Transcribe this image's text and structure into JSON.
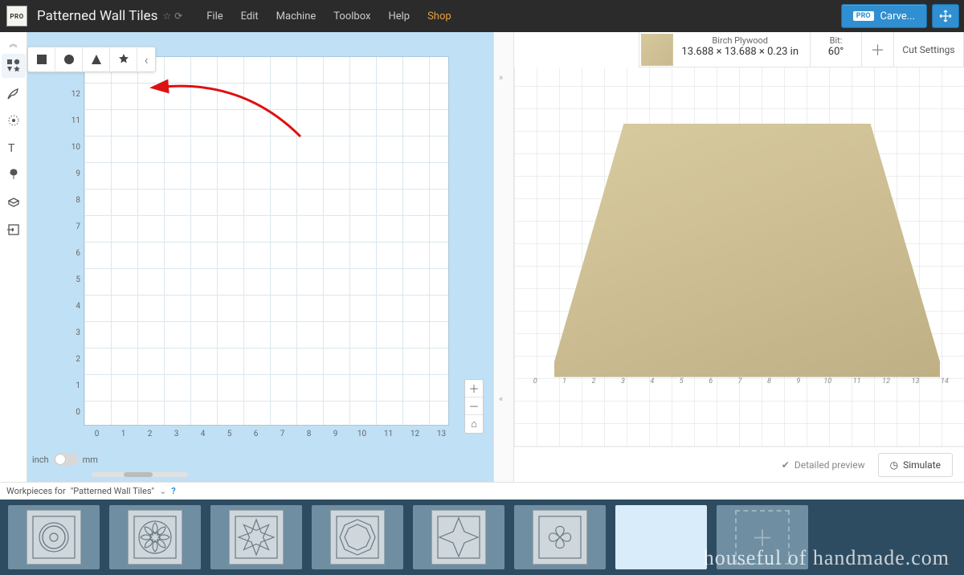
{
  "menubar": {
    "project_title": "Patterned Wall Tiles",
    "menus": [
      "File",
      "Edit",
      "Machine",
      "Toolbox",
      "Help",
      "Shop"
    ],
    "carve_label": "Carve...",
    "pro_badge": "PRO"
  },
  "left_tools": {
    "items": [
      "shapes-tool",
      "pen-tool",
      "drill-tool",
      "text-tool",
      "apps-tool",
      "blocks-tool",
      "import-tool"
    ]
  },
  "shape_flyout": {
    "shapes": [
      "square",
      "circle",
      "triangle",
      "star"
    ]
  },
  "canvas": {
    "ruler_ticks": [
      "0",
      "1",
      "2",
      "3",
      "4",
      "5",
      "6",
      "7",
      "8",
      "9",
      "10",
      "11",
      "12",
      "13"
    ],
    "unit_left": "inch",
    "unit_right": "mm"
  },
  "preview": {
    "material_name": "Birch Plywood",
    "material_dims": "13.688 × 13.688 × 0.23 in",
    "bit_label": "Bit:",
    "bit_value": "60°",
    "cut_settings": "Cut Settings",
    "axis_ticks": [
      "0",
      "1",
      "2",
      "3",
      "4",
      "5",
      "6",
      "7",
      "8",
      "9",
      "10",
      "11",
      "12",
      "13",
      "14"
    ],
    "detailed_label": "Detailed preview",
    "simulate_label": "Simulate"
  },
  "workpieces": {
    "header_prefix": "Workpieces for",
    "header_name": "\"Patterned Wall Tiles\"",
    "tiles": [
      "flower-medallion",
      "sun-medallion",
      "eight-point-star",
      "octagon",
      "compass-star",
      "petal-quad"
    ]
  },
  "watermark": "houseful of handmade.com"
}
